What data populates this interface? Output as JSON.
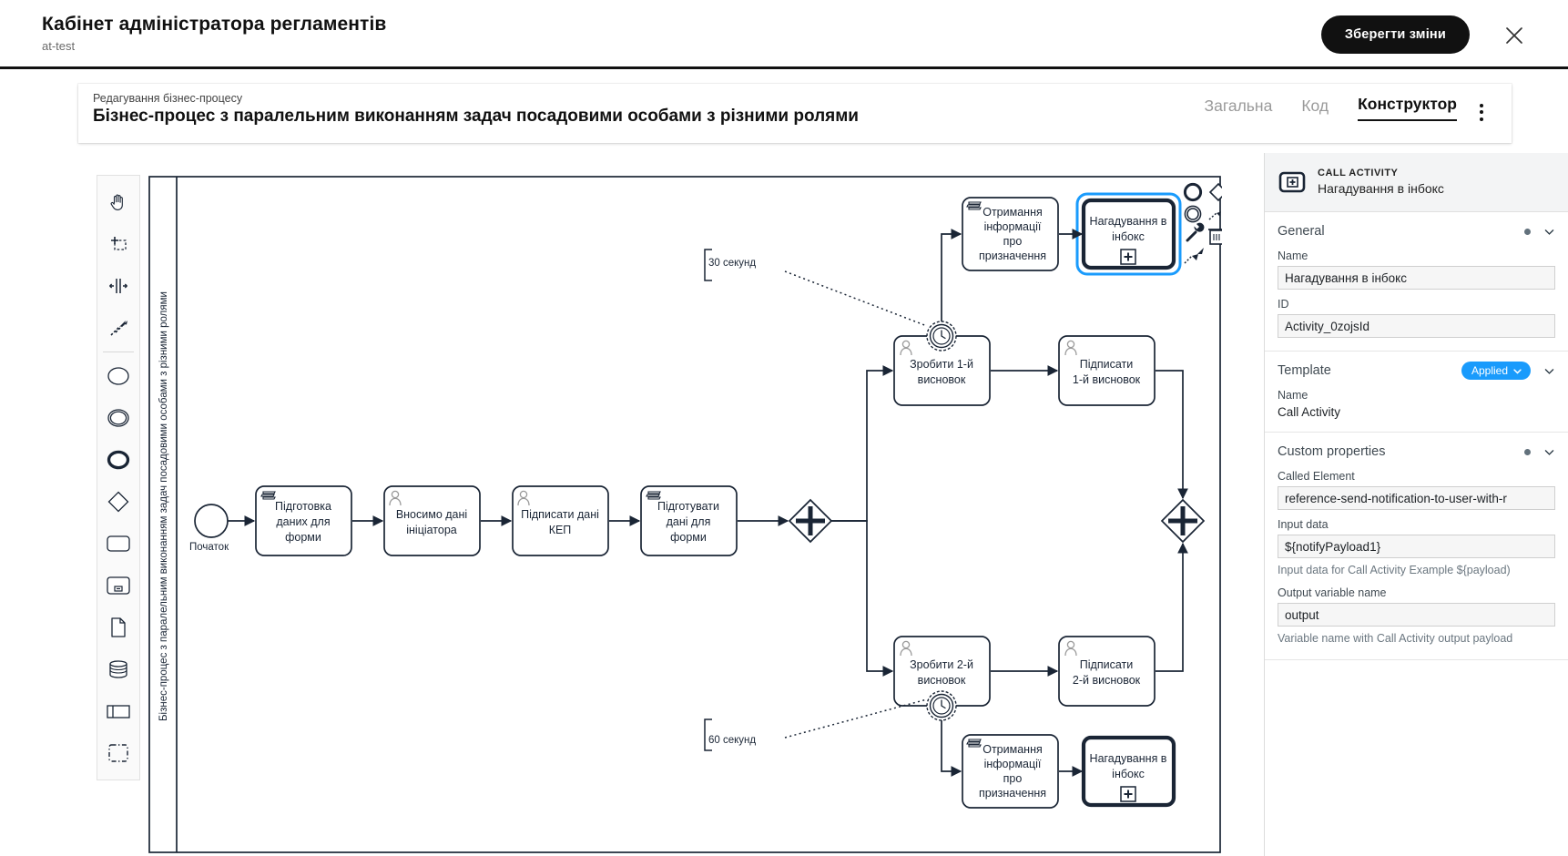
{
  "appbar": {
    "title": "Кабінет адміністратора регламентів",
    "subtitle": "at-test",
    "save_label": "Зберегти зміни",
    "close_icon": "close-icon",
    "accent": "#111111"
  },
  "editor": {
    "breadcrumb": "Редагування бізнес-процесу",
    "title": "Бізнес-процес з паралельним виконанням задач посадовими особами з різними ролями",
    "tabs": [
      {
        "label": "Загальна",
        "active": false
      },
      {
        "label": "Код",
        "active": false
      },
      {
        "label": "Конструктор",
        "active": true
      }
    ],
    "kebab_icon": "more-vertical-icon"
  },
  "palette": {
    "items": [
      {
        "name": "hand-tool-icon",
        "title": "Activate hand tool"
      },
      {
        "name": "lasso-tool-icon",
        "title": "Activate lasso tool"
      },
      {
        "name": "space-tool-icon",
        "title": "Activate create/remove space tool"
      },
      {
        "name": "global-connect-icon",
        "title": "Activate global connect tool"
      },
      {
        "name": "start-event-icon",
        "title": "Create start event"
      },
      {
        "name": "intermediate-event-icon",
        "title": "Create intermediate/boundary event"
      },
      {
        "name": "end-event-icon",
        "title": "Create end event"
      },
      {
        "name": "gateway-icon",
        "title": "Create gateway"
      },
      {
        "name": "task-icon",
        "title": "Create task"
      },
      {
        "name": "subprocess-icon",
        "title": "Create expanded sub-process"
      },
      {
        "name": "data-object-icon",
        "title": "Create data object reference"
      },
      {
        "name": "data-store-icon",
        "title": "Create data store reference"
      },
      {
        "name": "participant-icon",
        "title": "Create pool/participant"
      },
      {
        "name": "group-icon",
        "title": "Create group"
      }
    ]
  },
  "diagram": {
    "pool_label": "Бізнес-процес з паралельним виконанням задач посадовими особами з різними ролями",
    "start_event_label": "Початок",
    "tasks": {
      "t1": "Підготовка даних для форми",
      "t2": "Вносимо дані ініціатора",
      "t3": "Підписати дані КЕП",
      "t4": "Підготувати дані для форми",
      "t5": "Зробити 1-й висновок",
      "t6": "Підписати 1-й висновок",
      "t7": "Зробити 2-й висновок",
      "t8": "Підписати 2-й висновок",
      "t9": "Отримання інформації про призначення задачі",
      "t10": "Нагадування в інбокс",
      "t11": "Отримання інформації про призначення задачі",
      "t12": "Нагадування в інбокс"
    },
    "annotations": {
      "a1": "30 секунд",
      "a2": "60 секунд"
    },
    "selection_color": "#1a9bfc",
    "context_pad": [
      {
        "name": "append-end-event-icon"
      },
      {
        "name": "append-gateway-icon"
      },
      {
        "name": "append-task-icon"
      },
      {
        "name": "append-intermediate-event-icon"
      },
      {
        "name": "append-text-annotation-icon"
      },
      {
        "name": "connect-icon"
      },
      {
        "name": "wrench-icon"
      },
      {
        "name": "delete-icon"
      }
    ]
  },
  "properties": {
    "header": {
      "type": "CALL ACTIVITY",
      "name": "Нагадування в інбокс",
      "icon": "call-activity-icon"
    },
    "general": {
      "title": "General",
      "name_label": "Name",
      "name_value": "Нагадування в інбокс",
      "id_label": "ID",
      "id_value": "Activity_0zojsId"
    },
    "template": {
      "title": "Template",
      "badge": "Applied",
      "badge_color": "#1a9bfc",
      "name_label": "Name",
      "name_value": "Call Activity"
    },
    "custom": {
      "title": "Custom properties",
      "called_element_label": "Called Element",
      "called_element_value": "reference-send-notification-to-user-with-r",
      "input_data_label": "Input data",
      "input_data_value": "${notifyPayload1}",
      "input_data_hint": "Input data for Call Activity Example ${payload)",
      "output_label": "Output variable name",
      "output_value": "output",
      "output_hint": "Variable name with Call Activity output payload"
    }
  }
}
